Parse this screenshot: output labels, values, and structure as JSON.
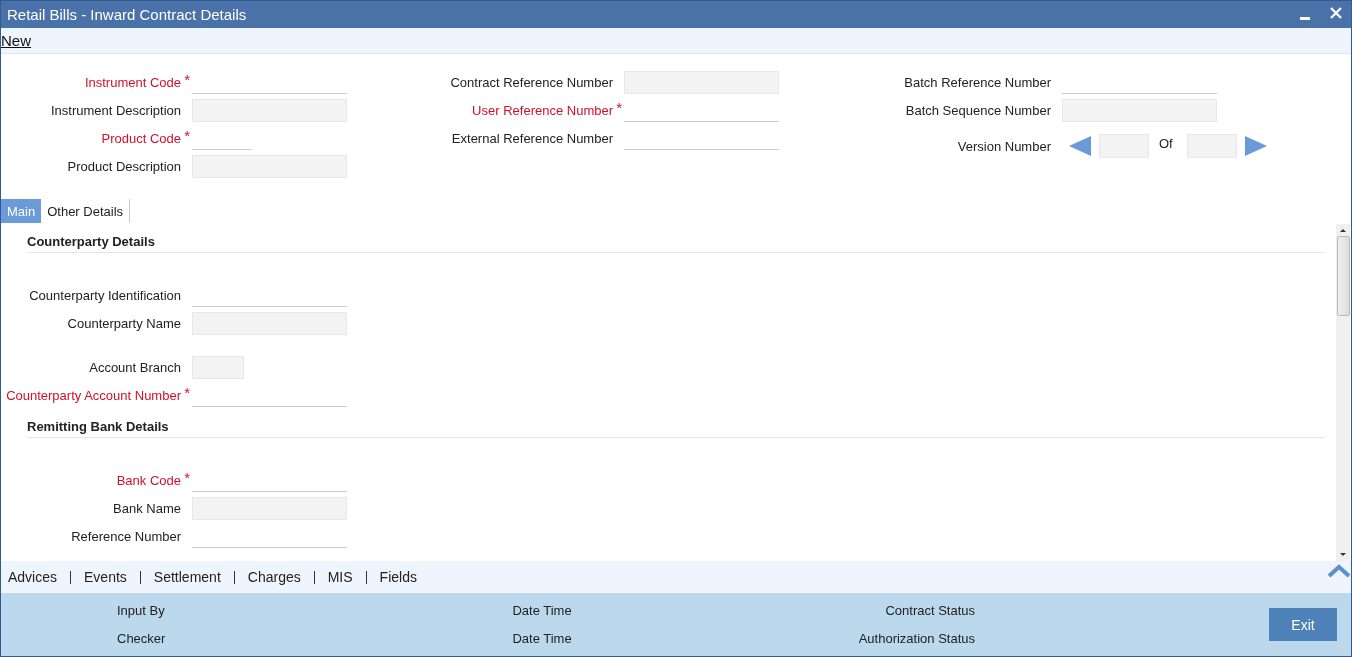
{
  "window": {
    "title": "Retail Bills - Inward Contract Details"
  },
  "toolbar": {
    "link": "New"
  },
  "header_columns": [
    {
      "fields": [
        {
          "label": "Instrument Code",
          "required_mark": "*",
          "kind": "line"
        },
        {
          "label": "Instrument Description",
          "kind": "box"
        },
        {
          "label": "Product Code",
          "required_mark": "*",
          "kind": "short-line"
        },
        {
          "label": "Product Description",
          "kind": "box"
        }
      ]
    },
    {
      "fields": [
        {
          "label": "Contract Reference Number",
          "kind": "box"
        },
        {
          "label": "User Reference Number",
          "required_mark": "*",
          "kind": "line"
        },
        {
          "label": "External Reference Number",
          "kind": "line"
        }
      ]
    },
    {
      "fields": [
        {
          "label": "Batch Reference Number",
          "kind": "line"
        },
        {
          "label": "Batch Sequence Number",
          "kind": "box"
        }
      ]
    }
  ],
  "version": {
    "label": "Version Number",
    "of": "Of"
  },
  "tabs": [
    {
      "label": "Main",
      "selected": true
    },
    {
      "label": "Other Details",
      "selected": false
    }
  ],
  "sections": [
    {
      "title": "Counterparty Details",
      "fields": [
        {
          "label": "Counterparty Identification",
          "kind": "line"
        },
        {
          "label": "Counterparty Name",
          "kind": "box"
        },
        {
          "label": "Account Branch",
          "kind": "short-box",
          "gap_before": true
        },
        {
          "label": "Counterparty Account Number",
          "required_mark": "*",
          "kind": "line"
        }
      ]
    },
    {
      "title": "Remitting Bank Details",
      "fields": [
        {
          "label": "Bank Code",
          "required_mark": "*",
          "kind": "line"
        },
        {
          "label": "Bank Name",
          "kind": "box"
        },
        {
          "label": "Reference Number",
          "kind": "line"
        }
      ]
    }
  ],
  "bottom_links": [
    "Advices",
    "Events",
    "Settlement",
    "Charges",
    "MIS",
    "Fields"
  ],
  "audit": [
    [
      "Input By",
      "Checker"
    ],
    [
      "Date Time",
      "Date Time"
    ],
    [
      "Contract Status",
      "Authorization Status"
    ]
  ],
  "exit_button": "Exit"
}
